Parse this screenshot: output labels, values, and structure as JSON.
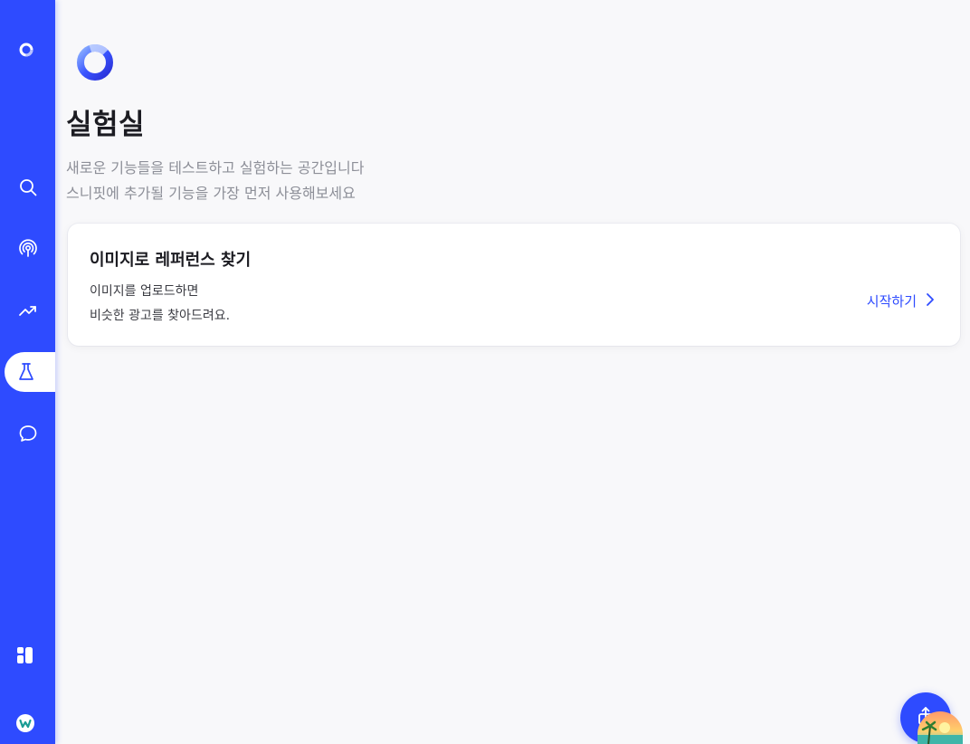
{
  "page": {
    "title": "실험실",
    "subtitle_line1": "새로운 기능들을 테스트하고 실험하는 공간입니다",
    "subtitle_line2": "스니핏에 추가될 기능을 가장 먼저 사용해보세요"
  },
  "card": {
    "title": "이미지로 레퍼런스 찾기",
    "desc_line1": "이미지를 업로드하면",
    "desc_line2": "비슷한 광고를 찾아드려요.",
    "action_label": "시작하기"
  },
  "sidebar": {
    "items": [
      {
        "name": "search",
        "icon": "search-icon",
        "active": false
      },
      {
        "name": "broadcast",
        "icon": "broadcast-icon",
        "active": false
      },
      {
        "name": "trending",
        "icon": "trending-up-icon",
        "active": false
      },
      {
        "name": "lab",
        "icon": "flask-icon",
        "active": true
      },
      {
        "name": "chat",
        "icon": "chat-icon",
        "active": false
      }
    ],
    "bottom": [
      {
        "name": "dashboard",
        "icon": "grid-icon"
      },
      {
        "name": "brand",
        "icon": "w-logo-icon"
      }
    ]
  },
  "colors": {
    "accent": "#2e4bff",
    "background": "#f8f8fa",
    "title": "#1c1c22",
    "muted": "#8d8f98"
  }
}
